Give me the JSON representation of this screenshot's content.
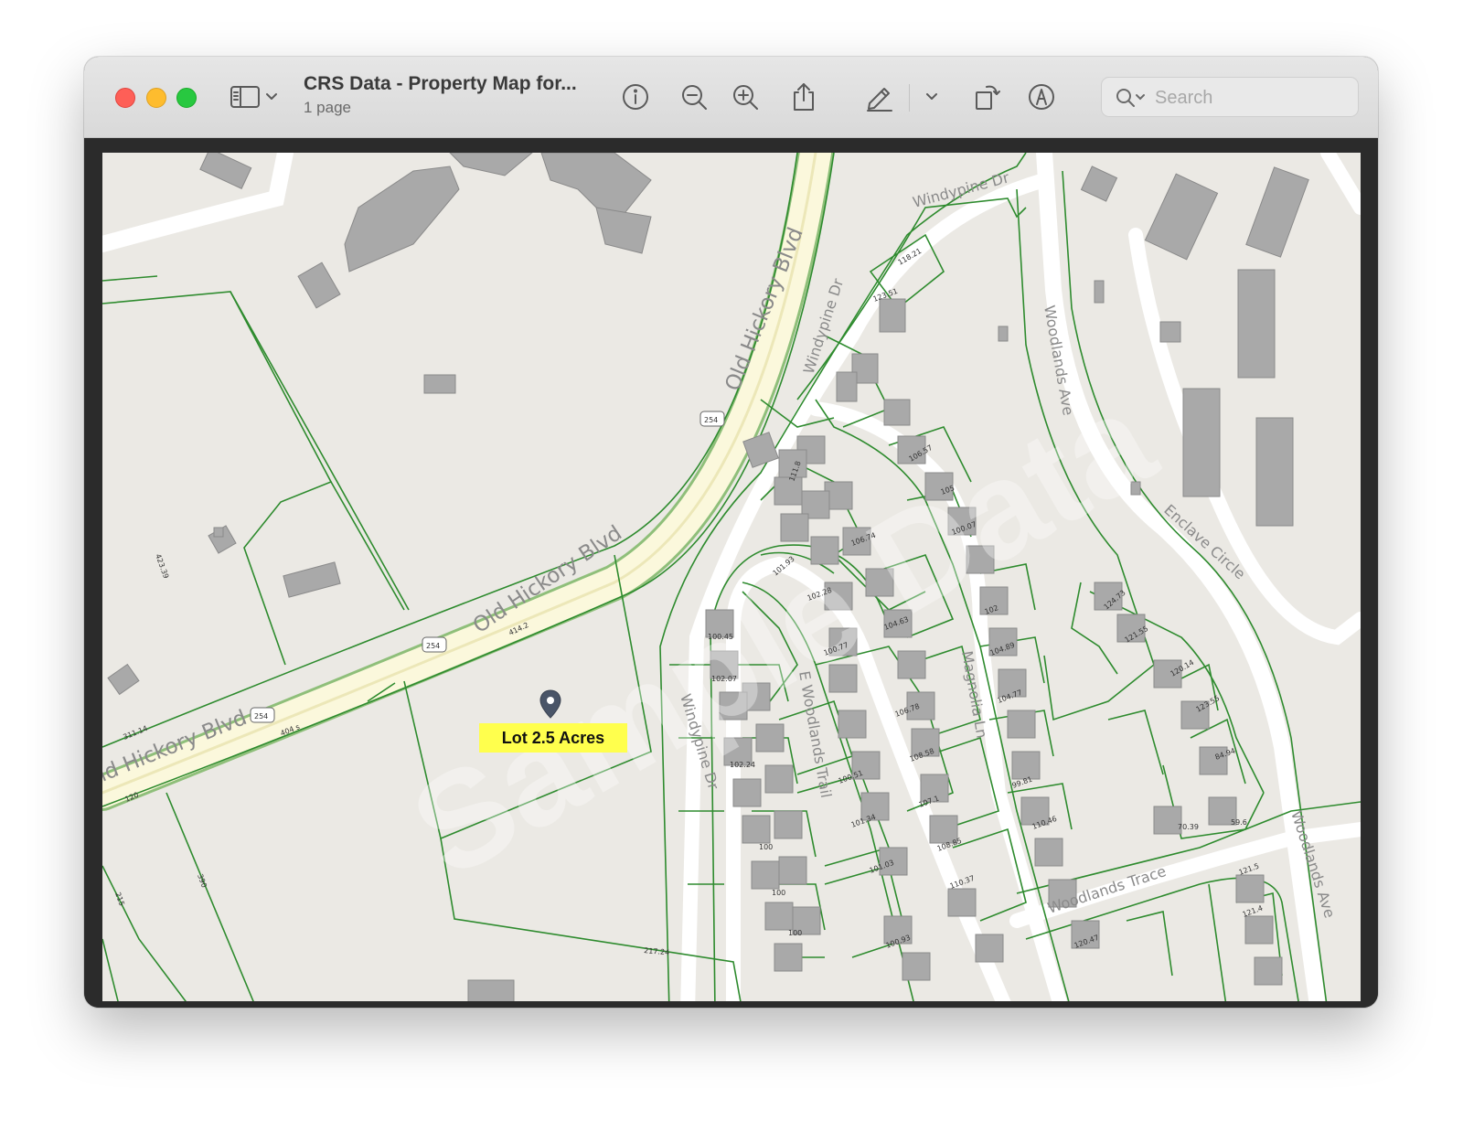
{
  "window": {
    "title": "CRS Data - Property Map for...",
    "subtitle": "1 page"
  },
  "toolbar": {
    "search_placeholder": "Search",
    "icons": [
      "sidebar-toggle-icon",
      "info-icon",
      "zoom-out-icon",
      "zoom-in-icon",
      "share-icon",
      "markup-pen-icon",
      "rotate-icon",
      "annotate-icon",
      "search-icon"
    ]
  },
  "map": {
    "lot_label": "Lot 2.5 Acres",
    "watermark": "Sample Data",
    "roads": {
      "old_hickory_1": "Old Hickory Blvd",
      "old_hickory_2": "Old Hickory Blvd",
      "old_hickory_3": "ld Hickory Blvd",
      "windypine_top": "Windypine Dr",
      "windypine_mid": "Windypine Dr",
      "windypine_low": "Windypine Dr",
      "woodlands_ave_1": "Woodlands Ave",
      "woodlands_ave_2": "Woodlands Ave",
      "enclave": "Enclave Circle",
      "e_woodlands": "E Woodlands Trail",
      "magnolia": "Magnolia Ln",
      "woodlands_trace": "Woodlands Trace"
    },
    "route_shields": [
      "254",
      "254",
      "254"
    ],
    "dims": [
      "414.2",
      "404 s",
      "311.14",
      "120",
      "215",
      "390",
      "217.24",
      "423.39",
      "106.74",
      "102.28",
      "100.77",
      "104.63",
      "106.78",
      "108.58",
      "107.1",
      "108.85",
      "110.46",
      "99.81",
      "104.77",
      "104.89",
      "102",
      "100.07",
      "105",
      "106.57",
      "123.51",
      "118.21",
      "100.45",
      "102.07",
      "102.24",
      "100",
      "100",
      "100",
      "100.51",
      "101.34",
      "101.03",
      "100.93",
      "120.47",
      "121.4",
      "121.5",
      "121.55",
      "123.55",
      "120.14",
      "124.73",
      "84.94",
      "59.6",
      "70.39",
      "111.8",
      "101.93",
      "110.37"
    ]
  },
  "colors": {
    "lot_line": "#2e8b2e",
    "road": "#ffffff",
    "highway": "#fbf8dc",
    "building": "#a9a9a9",
    "background": "#ebe9e4",
    "lot_label_bg": "#ffff4d"
  }
}
